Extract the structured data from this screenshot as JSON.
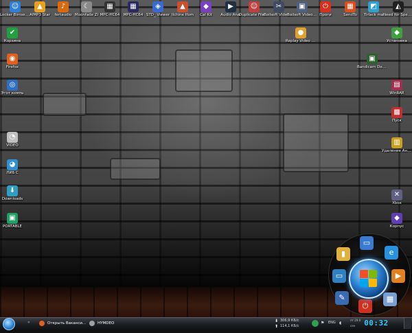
{
  "desktop": {
    "top_row": [
      {
        "label": "Locker Bimsemp",
        "icon": "user-icon",
        "color": "#2f7fd8",
        "glyph": "☺"
      },
      {
        "label": "AIMP3 Star",
        "icon": "aimp-icon",
        "color": "#e8a020",
        "glyph": "▲"
      },
      {
        "label": "fertaudio",
        "icon": "audio-icon",
        "color": "#d86a10",
        "glyph": "♪"
      },
      {
        "label": "Moonfade ZI",
        "icon": "moon-icon",
        "color": "#8a8a8a",
        "glyph": "☾"
      },
      {
        "label": "MPC-HC64",
        "icon": "film-icon",
        "color": "#333333",
        "glyph": "▦"
      },
      {
        "label": "MPC-HC64",
        "icon": "film-icon",
        "color": "#2a2a60",
        "glyph": "▦"
      },
      {
        "label": "STD_ Viewer",
        "icon": "viewer-icon",
        "color": "#3a6ad0",
        "glyph": "◈"
      },
      {
        "label": "Ilchine Ifom",
        "icon": "image-icon",
        "color": "#c85030",
        "glyph": "▲"
      },
      {
        "label": "Cal Kit",
        "icon": "kit-icon",
        "color": "#7a40c0",
        "glyph": "◆"
      },
      {
        "label": "Audio Anal",
        "icon": "play-icon",
        "color": "#203040",
        "glyph": "▶"
      },
      {
        "label": "Duplicate File Remover",
        "icon": "duplicate-icon",
        "color": "#c04040",
        "glyph": "☺"
      },
      {
        "label": "Boilsoft Video Splitt",
        "icon": "scissors-icon",
        "color": "#404a60",
        "glyph": "✂"
      },
      {
        "label": "Boilsoft Video Joi",
        "icon": "joiner-icon",
        "color": "#506080",
        "glyph": "▣"
      },
      {
        "label": "Проги",
        "icon": "power-icon",
        "color": "#d83020",
        "glyph": "⏻"
      },
      {
        "label": "SendTo",
        "icon": "grid-icon",
        "color": "#d85020",
        "glyph": "▦"
      },
      {
        "label": "Tirlack ma",
        "icon": "tiles-icon",
        "color": "#30a0d0",
        "glyph": "◩"
      },
      {
        "label": "Need for Speed Sh",
        "icon": "car-icon",
        "color": "#202020",
        "glyph": "◭"
      }
    ],
    "top_row2": [
      {
        "label": "Replay Video Capture 6",
        "icon": "replay-icon",
        "color": "#e0a030",
        "glyph": "●"
      }
    ],
    "left_col": [
      {
        "label": "Корзина",
        "icon": "recycle-icon",
        "color": "#20a040",
        "glyph": "✔"
      },
      {
        "label": "Firefox",
        "icon": "firefox-icon",
        "color": "#e06020",
        "glyph": "◉"
      },
      {
        "label": "Этот компь",
        "icon": "computer-icon",
        "color": "#3070c0",
        "glyph": "◎"
      },
      {
        "label": "VIDEO",
        "icon": "disk-icon",
        "color": "#c0c0c0",
        "glyph": "◔"
      },
      {
        "label": "ЛИБ C",
        "icon": "drive-icon",
        "color": "#3090d0",
        "glyph": "◕"
      },
      {
        "label": "Downloads",
        "icon": "download-icon",
        "color": "#30a0c0",
        "glyph": "⬇"
      },
      {
        "label": "PORTABLE",
        "icon": "portable-icon",
        "color": "#20a060",
        "glyph": "▣"
      }
    ],
    "right_col": [
      {
        "label": "Установка",
        "icon": "setup-icon",
        "color": "#40a040",
        "glyph": "◆"
      },
      {
        "label": "Bandicam Defaults",
        "icon": "bandicam-icon",
        "color": "#306030",
        "glyph": "▣"
      },
      {
        "label": "WinRAR",
        "icon": "archive-icon",
        "color": "#a03050",
        "glyph": "▤"
      },
      {
        "label": "Пуск",
        "icon": "start-icon",
        "color": "#c03030",
        "glyph": "▩"
      },
      {
        "label": "Удаление Аналоги",
        "icon": "uninstall-icon",
        "color": "#c8a020",
        "glyph": "▥"
      },
      {
        "label": "Xbox",
        "icon": "xbox-icon",
        "color": "#606080",
        "glyph": "✕"
      },
      {
        "label": "Корпус",
        "icon": "box-icon",
        "color": "#6040b0",
        "glyph": "◆"
      }
    ]
  },
  "launcher": {
    "slots": [
      {
        "name": "folder-icon",
        "color": "#e0b040",
        "glyph": "▮"
      },
      {
        "name": "monitor-icon",
        "color": "#3a7ad0",
        "glyph": "▭"
      },
      {
        "name": "ie-icon",
        "color": "#2a90e0",
        "glyph": "e"
      },
      {
        "name": "network-icon",
        "color": "#3080c0",
        "glyph": "▭"
      },
      {
        "name": "media-player-icon",
        "color": "#e08020",
        "glyph": "▶"
      },
      {
        "name": "tools-icon",
        "color": "#3a6ab0",
        "glyph": "✎"
      },
      {
        "name": "disk-icon",
        "color": "#5aa0e0",
        "glyph": "▱"
      },
      {
        "name": "calendar-icon",
        "color": "#7aa0d0",
        "glyph": "▦"
      },
      {
        "name": "power-icon",
        "color": "#d03020",
        "glyph": "⏻"
      }
    ]
  },
  "taskbar": {
    "buttons": [
      {
        "label": "Открыть Ваканси...",
        "icon": "firefox-icon",
        "color": "#e06020"
      },
      {
        "label": "HYMDEO",
        "icon": "app-icon",
        "color": "#a0a0a0"
      }
    ],
    "net_down": "306,9 КБ/с",
    "net_up": "114,1 КБ/с",
    "lang": "ENG",
    "time": "00:32",
    "day": "пт 29.0",
    "weekday": "сен"
  }
}
